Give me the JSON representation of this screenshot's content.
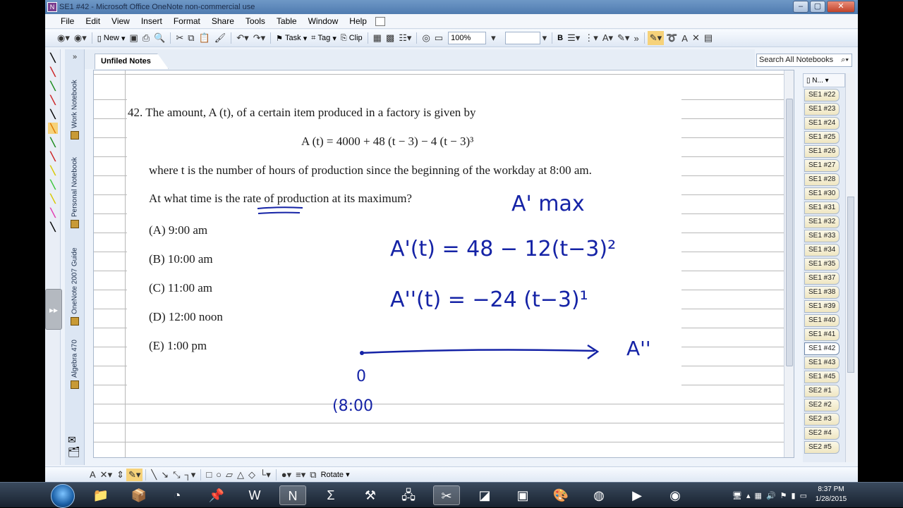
{
  "window": {
    "title": "SE1 #42 - Microsoft Office OneNote non-commercial use"
  },
  "menu": [
    "File",
    "Edit",
    "View",
    "Insert",
    "Format",
    "Share",
    "Tools",
    "Table",
    "Window",
    "Help"
  ],
  "toolbar": {
    "new_label": "New",
    "task_label": "Task",
    "tag_label": "Tag",
    "clip_label": "Clip",
    "zoom_value": "100%",
    "bold_label": "B"
  },
  "search": {
    "placeholder": "Search All Notebooks"
  },
  "notebooks": [
    "Work Notebook",
    "Personal Notebook",
    "OneNote 2007 Guide",
    "Algebra 470"
  ],
  "section_tab": "Unfiled Notes",
  "problem": {
    "number_line": "42. The amount, A (t), of a certain item produced in a factory is given by",
    "equation": "A (t) = 4000 + 48 (t − 3) − 4 (t − 3)³",
    "where_line": "where t is the number of hours of production since the beginning of the workday at 8:00 am.",
    "question": "At what time is the rate of production at its maximum?",
    "choices": [
      "(A)  9:00 am",
      "(B)  10:00 am",
      "(C)  11:00 am",
      "(D)  12:00 noon",
      "(E)  1:00 pm"
    ]
  },
  "handwriting": {
    "a_prime_max": "A' max",
    "first_derivative": "A'(t) = 48 − 12(t−3)²",
    "second_derivative": "A''(t) = −24 (t−3)¹",
    "arrow_label": "A''",
    "zero": "0",
    "time_note": "(8:00"
  },
  "pages_header": "N...",
  "pages": [
    "SE1 #22",
    "SE1 #23",
    "SE1 #24",
    "SE1 #25",
    "SE1 #26",
    "SE1 #27",
    "SE1 #28",
    "SE1 #30",
    "SE1 #31",
    "SE1 #32",
    "SE1 #33",
    "SE1 #34",
    "SE1 #35",
    "SE1 #37",
    "SE1 #38",
    "SE1 #39",
    "SE1 #40",
    "SE1 #41",
    "SE1 #42",
    "SE1 #43",
    "SE1 #45",
    "SE2 #1",
    "SE2 #2",
    "SE2 #3",
    "SE2 #4",
    "SE2 #5"
  ],
  "active_page": "SE1 #42",
  "drawing_toolbar": {
    "rotate_label": "Rotate"
  },
  "taskbar": {
    "time": "8:37 PM",
    "date": "1/28/2015"
  },
  "colors": {
    "ink_blue": "#1523a6",
    "title_bar": "#5a86bb",
    "page_tab_yellow": "#efe6c2"
  }
}
